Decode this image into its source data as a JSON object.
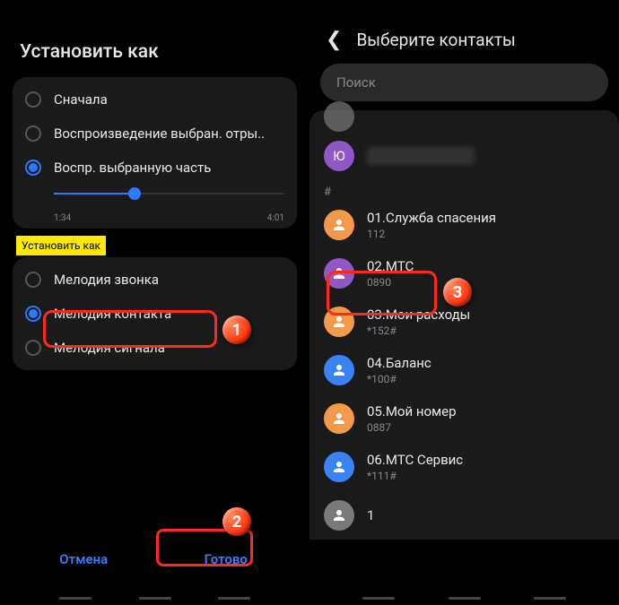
{
  "left": {
    "title": "Установить как",
    "playbackOptions": {
      "opt1": "Сначала",
      "opt2": "Воспроизведение выбран. отры..",
      "opt3": "Воспр. выбранную часть"
    },
    "time": {
      "start": "1:34",
      "end": "4:01"
    },
    "tag": "Установить как",
    "setAs": {
      "opt1": "Мелодия звонка",
      "opt2": "Мелодия контакта",
      "opt3": "Мелодия сигнала"
    },
    "buttons": {
      "cancel": "Отмена",
      "done": "Готово"
    }
  },
  "right": {
    "header": "Выберите контакты",
    "searchPlaceholder": "Поиск",
    "avatarLetter": "Ю",
    "sectionHash": "#",
    "contacts": [
      {
        "name": "01.Служба спасения",
        "sub": "112",
        "color": "orange"
      },
      {
        "name": "02.МТС",
        "sub": "0890",
        "color": "purple"
      },
      {
        "name": "03.Мои расходы",
        "sub": "*152#",
        "color": "orange"
      },
      {
        "name": "04.Баланс",
        "sub": "*100#",
        "color": "blue"
      },
      {
        "name": "05.Мой номер",
        "sub": "0887",
        "color": "orange"
      },
      {
        "name": "06.МТС Сервис",
        "sub": "*111#",
        "color": "blue"
      },
      {
        "name": "1",
        "sub": "",
        "color": "gray"
      }
    ]
  },
  "steps": {
    "s1": "1",
    "s2": "2",
    "s3": "3"
  }
}
